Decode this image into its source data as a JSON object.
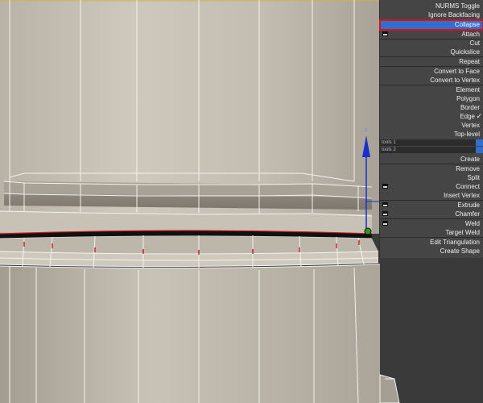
{
  "quad_menu": {
    "items": [
      {
        "label": "NURMS Toggle"
      },
      {
        "label": "Ignore Backfacing"
      },
      {
        "label": "Collapse",
        "selected": true
      },
      {
        "label": "Attach",
        "icon": "settings-box-icon"
      },
      {
        "label": "Cut"
      },
      {
        "label": "Quickslice"
      },
      {
        "label": "Repeat"
      },
      {
        "label": "Convert to Face"
      },
      {
        "label": "Convert to Vertex"
      },
      {
        "label": "Element"
      },
      {
        "label": "Polygon"
      },
      {
        "label": "Border"
      },
      {
        "label": "Edge",
        "checked": true
      },
      {
        "label": "Vertex"
      },
      {
        "label": "Top-level"
      },
      {
        "label": "tools 1"
      },
      {
        "label": "tools 2"
      },
      {
        "label": "Create"
      },
      {
        "label": "Remove"
      },
      {
        "label": "Split"
      },
      {
        "label": "Connect",
        "icon": "settings-box-icon"
      },
      {
        "label": "Insert Vertex"
      },
      {
        "label": "Extrude",
        "icon": "settings-box-icon"
      },
      {
        "label": "Chamfer",
        "icon": "settings-box-icon"
      },
      {
        "label": "Weld",
        "icon": "settings-box-icon"
      },
      {
        "label": "Target Weld"
      },
      {
        "label": "Edit Triangulation"
      },
      {
        "label": "Create Shape"
      }
    ],
    "check_mark": "✓"
  },
  "gizmo": {
    "axis_label": "z"
  },
  "colors": {
    "mesh": "#c7c0b4",
    "edge_wire": "#ffffff",
    "selected_edge": "#d01818",
    "menu_bg": "#454545",
    "highlight": "#2f6fd1",
    "highlight_border": "#e01010",
    "gizmo_z": "#1a2fd0",
    "gizmo_center": "#2f9a1f"
  }
}
